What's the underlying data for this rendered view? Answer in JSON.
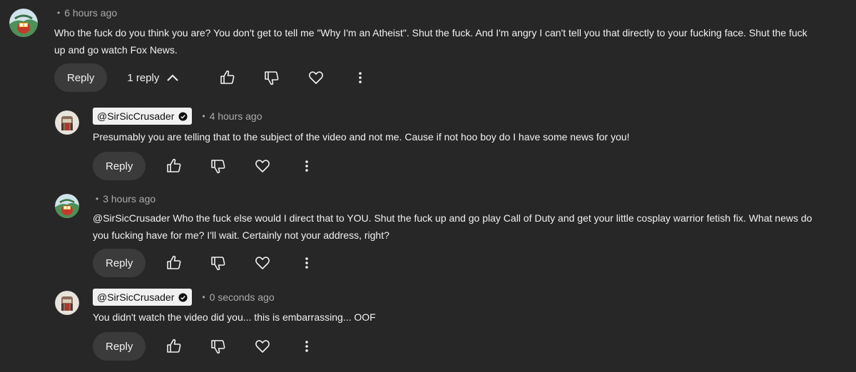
{
  "comments": [
    {
      "timestamp": "6 hours ago",
      "text_lines": [
        "Who the fuck do you think you are?  You don't get to tell me \"Why I'm an Atheist\".  Shut the fuck.  And I'm angry I can't tell you that directly to your fucking face. Shut the fuck",
        "up and go watch Fox News."
      ],
      "reply_label": "Reply",
      "replies_label": "1 reply"
    },
    {
      "author": "@SirSicCrusader",
      "verified": true,
      "timestamp": "4 hours ago",
      "text_lines": [
        "Presumably you are telling that to the subject of the video and not me. Cause if not hoo boy do I have some news for you!"
      ],
      "reply_label": "Reply"
    },
    {
      "timestamp": "3 hours ago",
      "text_lines": [
        "@SirSicCrusader Who the fuck else would I direct that to  YOU.  Shut the fuck up and go play Call of Duty and get your little cosplay warrior fetish fix.  What news do",
        "you fucking have for me?  I'll wait.  Certainly not your address, right?"
      ],
      "reply_label": "Reply"
    },
    {
      "author": "@SirSicCrusader",
      "verified": true,
      "timestamp": "0 seconds ago",
      "text_lines": [
        "You didn't watch the video did you... this is embarrassing... OOF"
      ],
      "reply_label": "Reply"
    }
  ],
  "icons": {
    "like": "thumbs-up-icon",
    "dislike": "thumbs-down-icon",
    "heart": "heart-icon",
    "more": "more-vert-icon",
    "collapse": "chevron-up-icon",
    "verified": "verified-check-icon"
  },
  "colors": {
    "background": "#272727",
    "text": "#f1f1f1",
    "secondary_text": "#aaaaaa",
    "button_bg": "#3b3b3b"
  }
}
